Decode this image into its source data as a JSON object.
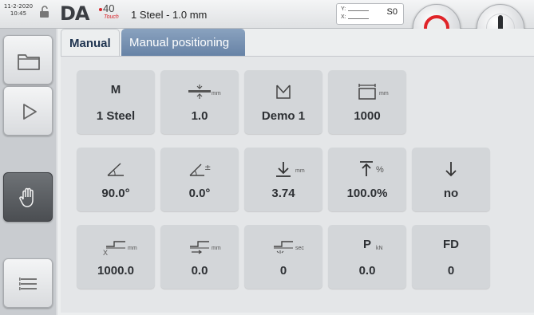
{
  "header": {
    "date": "11-2-2020",
    "time": "10:45",
    "logo_text": "DA",
    "logo_model": "40",
    "logo_sub": "Touch",
    "program_title": "1  Steel - 1.0 mm",
    "axis_y_label": "Y:",
    "axis_x_label": "X:",
    "axis_value": "S0"
  },
  "sidebar": {
    "items": [
      {
        "name": "folder-icon",
        "active": false
      },
      {
        "name": "play-icon",
        "active": false
      },
      {
        "name": "hand-icon",
        "active": true
      },
      {
        "name": "menu-list-icon",
        "active": false
      }
    ]
  },
  "tabs": {
    "manual": "Manual",
    "manual_positioning": "Manual positioning"
  },
  "tiles": {
    "row1": [
      {
        "label": "M",
        "unit": "",
        "value": "1  Steel",
        "icon": "material-icon"
      },
      {
        "label": "",
        "unit": "mm",
        "value": "1.0",
        "icon": "thickness-icon"
      },
      {
        "label": "",
        "unit": "",
        "value": "Demo 1",
        "icon": "die-icon"
      },
      {
        "label": "",
        "unit": "mm",
        "value": "1000",
        "icon": "width-icon"
      }
    ],
    "row2": [
      {
        "label": "",
        "unit": "",
        "value": "90.0°",
        "icon": "angle-icon"
      },
      {
        "label": "",
        "unit": "",
        "value": "0.0°",
        "icon": "angle-correction-icon"
      },
      {
        "label": "",
        "unit": "mm",
        "value": "3.74",
        "icon": "depth-icon"
      },
      {
        "label": "",
        "unit": "%",
        "value": "100.0%",
        "icon": "force-percent-icon"
      },
      {
        "label": "",
        "unit": "",
        "value": "no",
        "icon": "decompression-icon"
      }
    ],
    "row3": [
      {
        "label": "",
        "unit": "mm",
        "value": "1000.0",
        "axis_letter": "X",
        "icon": "backgauge-x-icon"
      },
      {
        "label": "",
        "unit": "mm",
        "value": "0.0",
        "icon": "retract-icon"
      },
      {
        "label": "",
        "unit": "sec",
        "value": "0",
        "icon": "dwell-icon"
      },
      {
        "label": "P",
        "unit": "kN",
        "value": "0.0",
        "icon": "pressure-icon"
      },
      {
        "label": "FD",
        "unit": "",
        "value": "0",
        "icon": "fd-icon"
      }
    ]
  },
  "colors": {
    "accent_tab": "#7590b2",
    "stop_red": "#e02328",
    "sidebar_active": "#55595d"
  }
}
